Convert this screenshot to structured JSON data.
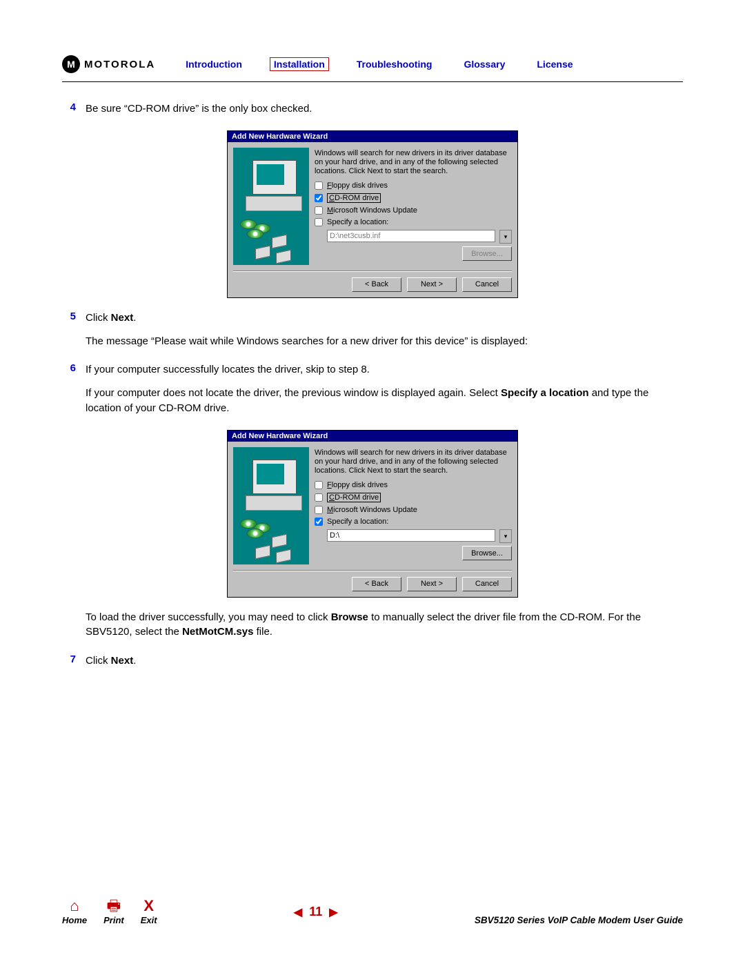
{
  "brand": {
    "logo_letter": "M",
    "logo_text": "MOTOROLA"
  },
  "nav": {
    "introduction": "Introduction",
    "installation": "Installation",
    "troubleshooting": "Troubleshooting",
    "glossary": "Glossary",
    "license": "License"
  },
  "steps": {
    "s4": {
      "num": "4",
      "text": "Be sure “CD-ROM drive” is the only box checked."
    },
    "s5": {
      "num": "5",
      "line1_a": "Click ",
      "line1_b": "Next",
      "line1_c": ".",
      "line2": "The message “Please wait while Windows searches for a new driver for this device” is displayed:"
    },
    "s6": {
      "num": "6",
      "line1": "If your computer successfully locates the driver, skip to step 8.",
      "line2_a": "If your computer does not locate the driver, the previous window is displayed again. Select ",
      "line2_b": "Specify a location",
      "line2_c": " and type the location of your CD-ROM drive.",
      "line3_a": "To load the driver successfully, you may need to click ",
      "line3_b": "Browse",
      "line3_c": " to manually select the driver file from the CD-ROM. For the SBV5120, select the ",
      "line3_d": "NetMotCM.sys",
      "line3_e": " file."
    },
    "s7": {
      "num": "7",
      "line1_a": "Click ",
      "line1_b": "Next",
      "line1_c": "."
    }
  },
  "dialog": {
    "title": "Add New Hardware Wizard",
    "intro": "Windows will search for new drivers in its driver database on your hard drive, and in any of the following selected locations. Click Next to start the search.",
    "opt_floppy": "Floppy disk drives",
    "opt_cdrom": "CD-ROM drive",
    "opt_winupd": "Microsoft Windows Update",
    "opt_specify": "Specify a location:",
    "loc_disabled": "D:\\net3cusb.inf",
    "loc_enabled": "D:\\",
    "btn_browse": "Browse...",
    "btn_back": "< Back",
    "btn_next": "Next >",
    "btn_cancel": "Cancel"
  },
  "footer": {
    "home": "Home",
    "print": "Print",
    "exit": "Exit",
    "page": "11",
    "guide": "SBV5120 Series VoIP Cable Modem User Guide"
  }
}
